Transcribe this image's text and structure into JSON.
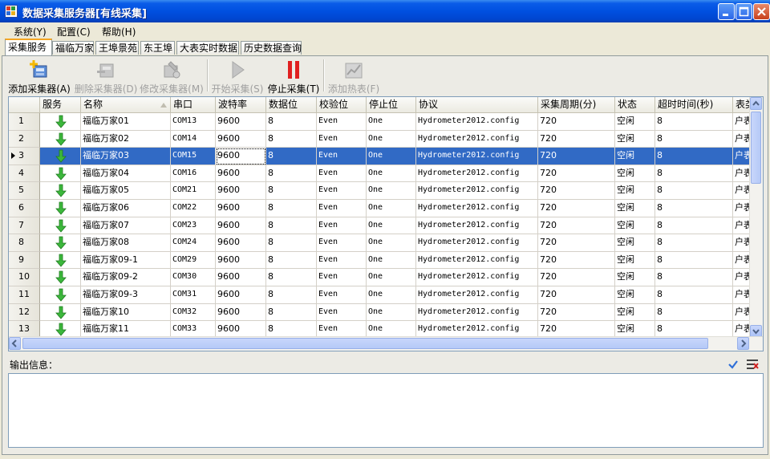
{
  "window": {
    "title": "数据采集服务器[有线采集]"
  },
  "menu": [
    {
      "label": "系统(Y)"
    },
    {
      "label": "配置(C)"
    },
    {
      "label": "帮助(H)"
    }
  ],
  "tabs": [
    {
      "label": "采集服务",
      "active": true
    },
    {
      "label": "福临万家"
    },
    {
      "label": "王埠景苑"
    },
    {
      "label": "东王埠"
    },
    {
      "label": "大表实时数据"
    },
    {
      "label": "历史数据查询"
    }
  ],
  "toolbar": {
    "add": {
      "label": "添加采集器(A)",
      "icon": "add-collector-icon"
    },
    "delete": {
      "label": "删除采集器(D)",
      "icon": "delete-collector-icon"
    },
    "edit": {
      "label": "修改采集器(M)",
      "icon": "edit-collector-icon"
    },
    "start": {
      "label": "开始采集(S)",
      "icon": "play-icon"
    },
    "stop": {
      "label": "停止采集(T)",
      "icon": "pause-icon"
    },
    "addmeter": {
      "label": "添加热表(F)",
      "icon": "add-meter-icon"
    }
  },
  "grid": {
    "columns": [
      "服务",
      "名称",
      "串口",
      "波特率",
      "数据位",
      "校验位",
      "停止位",
      "协议",
      "采集周期(分)",
      "状态",
      "超时时间(秒)",
      "表类"
    ],
    "selected_row": 3,
    "rows": [
      {
        "num": "1",
        "name": "福临万家01",
        "port": "COM13",
        "baud": "9600",
        "databits": "8",
        "parity": "Even",
        "stopbits": "One",
        "protocol": "Hydrometer2012.config",
        "period": "720",
        "status": "空闲",
        "timeout": "8",
        "type": "户表"
      },
      {
        "num": "2",
        "name": "福临万家02",
        "port": "COM14",
        "baud": "9600",
        "databits": "8",
        "parity": "Even",
        "stopbits": "One",
        "protocol": "Hydrometer2012.config",
        "period": "720",
        "status": "空闲",
        "timeout": "8",
        "type": "户表"
      },
      {
        "num": "3",
        "name": "福临万家03",
        "port": "COM15",
        "baud": "9600",
        "databits": "8",
        "parity": "Even",
        "stopbits": "One",
        "protocol": "Hydrometer2012.config",
        "period": "720",
        "status": "空闲",
        "timeout": "8",
        "type": "户表"
      },
      {
        "num": "4",
        "name": "福临万家04",
        "port": "COM16",
        "baud": "9600",
        "databits": "8",
        "parity": "Even",
        "stopbits": "One",
        "protocol": "Hydrometer2012.config",
        "period": "720",
        "status": "空闲",
        "timeout": "8",
        "type": "户表"
      },
      {
        "num": "5",
        "name": "福临万家05",
        "port": "COM21",
        "baud": "9600",
        "databits": "8",
        "parity": "Even",
        "stopbits": "One",
        "protocol": "Hydrometer2012.config",
        "period": "720",
        "status": "空闲",
        "timeout": "8",
        "type": "户表"
      },
      {
        "num": "6",
        "name": "福临万家06",
        "port": "COM22",
        "baud": "9600",
        "databits": "8",
        "parity": "Even",
        "stopbits": "One",
        "protocol": "Hydrometer2012.config",
        "period": "720",
        "status": "空闲",
        "timeout": "8",
        "type": "户表"
      },
      {
        "num": "7",
        "name": "福临万家07",
        "port": "COM23",
        "baud": "9600",
        "databits": "8",
        "parity": "Even",
        "stopbits": "One",
        "protocol": "Hydrometer2012.config",
        "period": "720",
        "status": "空闲",
        "timeout": "8",
        "type": "户表"
      },
      {
        "num": "8",
        "name": "福临万家08",
        "port": "COM24",
        "baud": "9600",
        "databits": "8",
        "parity": "Even",
        "stopbits": "One",
        "protocol": "Hydrometer2012.config",
        "period": "720",
        "status": "空闲",
        "timeout": "8",
        "type": "户表"
      },
      {
        "num": "9",
        "name": "福临万家09-1",
        "port": "COM29",
        "baud": "9600",
        "databits": "8",
        "parity": "Even",
        "stopbits": "One",
        "protocol": "Hydrometer2012.config",
        "period": "720",
        "status": "空闲",
        "timeout": "8",
        "type": "户表"
      },
      {
        "num": "10",
        "name": "福临万家09-2",
        "port": "COM30",
        "baud": "9600",
        "databits": "8",
        "parity": "Even",
        "stopbits": "One",
        "protocol": "Hydrometer2012.config",
        "period": "720",
        "status": "空闲",
        "timeout": "8",
        "type": "户表"
      },
      {
        "num": "11",
        "name": "福临万家09-3",
        "port": "COM31",
        "baud": "9600",
        "databits": "8",
        "parity": "Even",
        "stopbits": "One",
        "protocol": "Hydrometer2012.config",
        "period": "720",
        "status": "空闲",
        "timeout": "8",
        "type": "户表"
      },
      {
        "num": "12",
        "name": "福临万家10",
        "port": "COM32",
        "baud": "9600",
        "databits": "8",
        "parity": "Even",
        "stopbits": "One",
        "protocol": "Hydrometer2012.config",
        "period": "720",
        "status": "空闲",
        "timeout": "8",
        "type": "户表"
      },
      {
        "num": "13",
        "name": "福临万家11",
        "port": "COM33",
        "baud": "9600",
        "databits": "8",
        "parity": "Even",
        "stopbits": "One",
        "protocol": "Hydrometer2012.config",
        "period": "720",
        "status": "空闲",
        "timeout": "8",
        "type": "户表"
      }
    ]
  },
  "output": {
    "label": "输出信息：",
    "content": ""
  },
  "colors": {
    "selection": "#316ac5",
    "title_bar": "#0054e3",
    "service_arrow": "#3cb83c"
  }
}
